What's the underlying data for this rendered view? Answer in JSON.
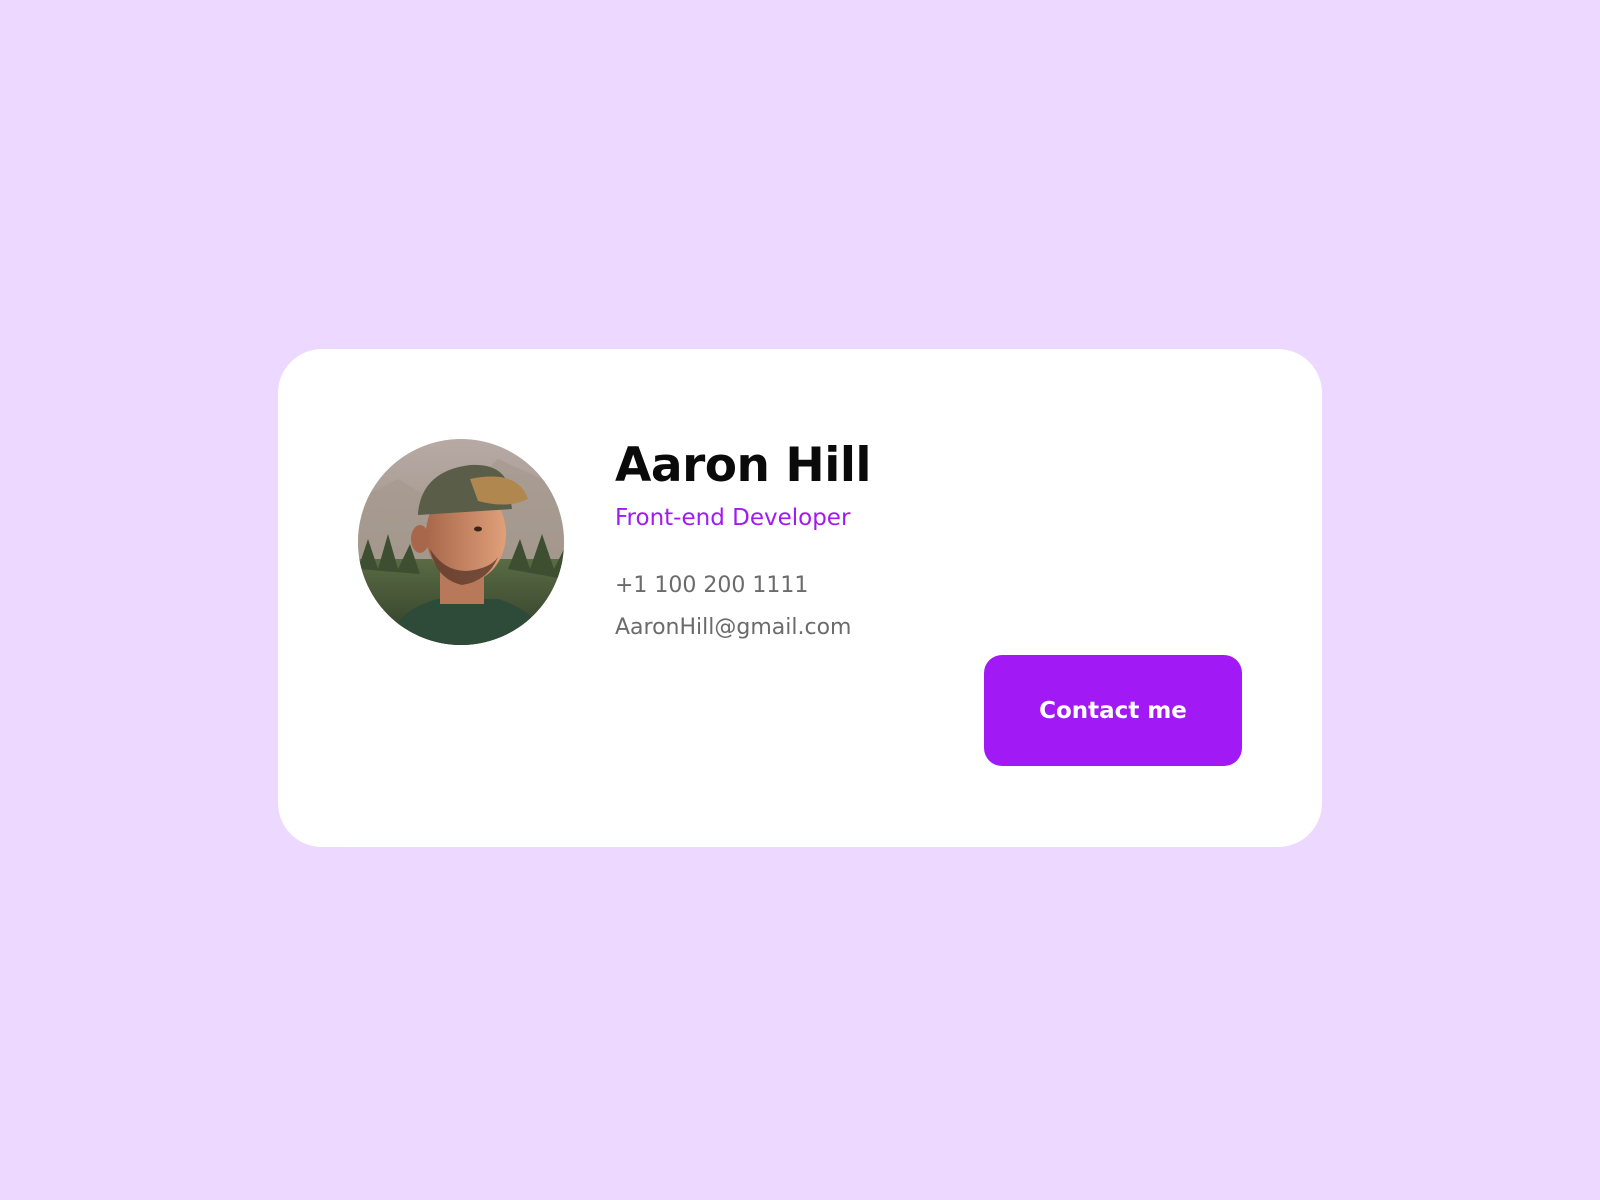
{
  "profile": {
    "name": "Aaron Hill",
    "role": "Front-end Developer",
    "phone": "+1 100 200 1111",
    "email": "AaronHill@gmail.com",
    "contact_label": "Contact me"
  },
  "colors": {
    "background": "#EDD9FF",
    "card": "#FFFFFF",
    "accent": "#A11AF5",
    "name_text": "#0A0A0A",
    "muted_text": "#6B6B6B"
  },
  "icons": {
    "avatar": "profile-photo"
  }
}
